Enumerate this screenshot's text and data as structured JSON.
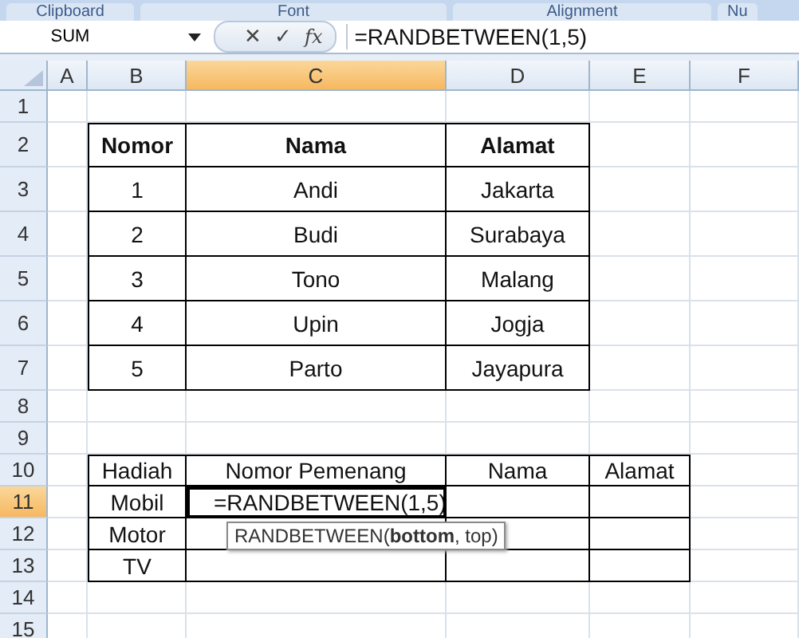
{
  "ribbon_groups": [
    "Clipboard",
    "Font",
    "Alignment",
    "Nu"
  ],
  "formula_bar": {
    "name_box": "SUM",
    "cancel": "✕",
    "enter": "✓",
    "function": "fx",
    "formula": "=RANDBETWEEN(1,5)"
  },
  "columns": [
    {
      "label": "A",
      "selected": false
    },
    {
      "label": "B",
      "selected": false
    },
    {
      "label": "C",
      "selected": true
    },
    {
      "label": "D",
      "selected": false
    },
    {
      "label": "E",
      "selected": false
    },
    {
      "label": "F",
      "selected": false
    }
  ],
  "rows": [
    {
      "number": "1",
      "selected": false,
      "kind": "normal"
    },
    {
      "number": "2",
      "selected": false,
      "kind": "tall",
      "cells": [
        {},
        {
          "text": "Nomor",
          "boxed": true,
          "bold": true
        },
        {
          "text": "Nama",
          "boxed": true,
          "bold": true
        },
        {
          "text": "Alamat",
          "boxed": true,
          "bold": true
        }
      ]
    },
    {
      "number": "3",
      "selected": false,
      "kind": "tall",
      "cells": [
        {},
        {
          "text": "1",
          "boxed": true
        },
        {
          "text": "Andi",
          "boxed": true
        },
        {
          "text": "Jakarta",
          "boxed": true
        }
      ]
    },
    {
      "number": "4",
      "selected": false,
      "kind": "tall",
      "cells": [
        {},
        {
          "text": "2",
          "boxed": true
        },
        {
          "text": "Budi",
          "boxed": true
        },
        {
          "text": "Surabaya",
          "boxed": true
        }
      ]
    },
    {
      "number": "5",
      "selected": false,
      "kind": "tall",
      "cells": [
        {},
        {
          "text": "3",
          "boxed": true
        },
        {
          "text": "Tono",
          "boxed": true
        },
        {
          "text": "Malang",
          "boxed": true
        }
      ]
    },
    {
      "number": "6",
      "selected": false,
      "kind": "tall",
      "cells": [
        {},
        {
          "text": "4",
          "boxed": true
        },
        {
          "text": "Upin",
          "boxed": true
        },
        {
          "text": "Jogja",
          "boxed": true
        }
      ]
    },
    {
      "number": "7",
      "selected": false,
      "kind": "tall",
      "cells": [
        {},
        {
          "text": "5",
          "boxed": true
        },
        {
          "text": "Parto",
          "boxed": true
        },
        {
          "text": "Jayapura",
          "boxed": true
        }
      ]
    },
    {
      "number": "8",
      "selected": false,
      "kind": "normal"
    },
    {
      "number": "9",
      "selected": false,
      "kind": "normal"
    },
    {
      "number": "10",
      "selected": false,
      "kind": "normal",
      "cells": [
        {},
        {
          "text": "Hadiah",
          "boxed": true
        },
        {
          "text": "Nomor Pemenang",
          "boxed": true
        },
        {
          "text": "Nama",
          "boxed": true
        },
        {
          "text": "Alamat",
          "boxed": true
        }
      ]
    },
    {
      "number": "11",
      "selected": true,
      "kind": "normal",
      "cells": [
        {},
        {
          "text": "Mobil",
          "boxed": true
        },
        {
          "text": "=RANDBETWEEN(1,5)",
          "boxed": true,
          "active": true,
          "tooltip": "RANDBETWEEN(**bottom**, top)"
        },
        {
          "boxed": true
        },
        {
          "boxed": true
        }
      ]
    },
    {
      "number": "12",
      "selected": false,
      "kind": "normal",
      "cells": [
        {},
        {
          "text": "Motor",
          "boxed": true
        },
        {
          "boxed": true
        },
        {
          "boxed": true
        },
        {
          "boxed": true
        }
      ]
    },
    {
      "number": "13",
      "selected": false,
      "kind": "normal",
      "cells": [
        {},
        {
          "text": "TV",
          "boxed": true
        },
        {
          "boxed": true
        },
        {
          "boxed": true
        },
        {
          "boxed": true
        }
      ]
    },
    {
      "number": "14",
      "selected": false,
      "kind": "normal"
    },
    {
      "number": "15",
      "selected": false,
      "kind": "normal"
    }
  ]
}
